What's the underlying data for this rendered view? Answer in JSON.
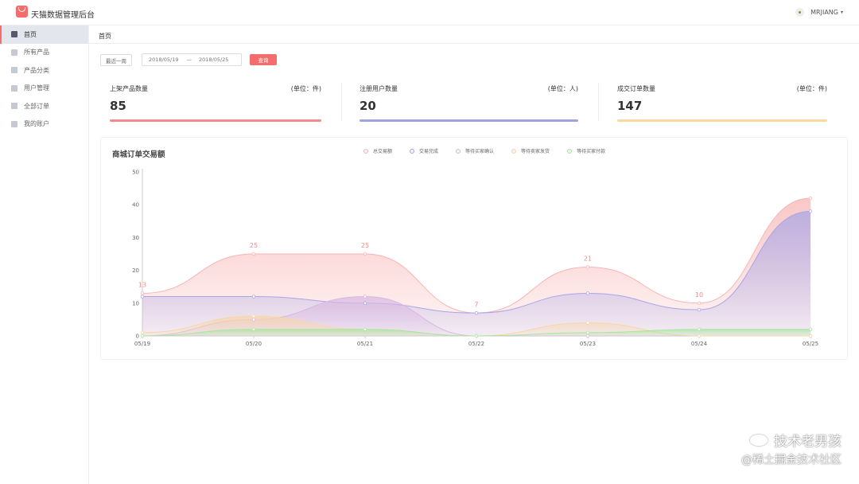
{
  "app": {
    "title": "天猫数据管理后台"
  },
  "user": {
    "name": "MRJIANG",
    "caret": "▾"
  },
  "sidebar": {
    "items": [
      {
        "label": "首页",
        "icon": "home-icon"
      },
      {
        "label": "所有产品",
        "icon": "product-icon"
      },
      {
        "label": "产品分类",
        "icon": "category-icon"
      },
      {
        "label": "用户管理",
        "icon": "user-icon"
      },
      {
        "label": "全部订单",
        "icon": "order-icon"
      },
      {
        "label": "我的账户",
        "icon": "gear-icon"
      }
    ]
  },
  "breadcrumb": "首页",
  "filter": {
    "range_button": "最近一周",
    "start_date": "2018/05/19",
    "separator": "—",
    "end_date": "2018/05/25",
    "query_button": "查询"
  },
  "stats": [
    {
      "title": "上架产品数量",
      "unit": "(单位：件)",
      "value": "85",
      "color": "#f28b8b"
    },
    {
      "title": "注册用户数量",
      "unit": "(单位：人)",
      "value": "20",
      "color": "#9fa3e3"
    },
    {
      "title": "成交订单数量",
      "unit": "(单位：件)",
      "value": "147",
      "color": "#f9d9a0"
    }
  ],
  "watermark": {
    "line1": "技术老男孩",
    "line2": "@稀土掘金技术社区"
  },
  "chart_data": {
    "type": "area",
    "title": "商城订单交易额",
    "categories": [
      "05/19",
      "05/20",
      "05/21",
      "05/22",
      "05/23",
      "05/24",
      "05/25"
    ],
    "ylim": [
      0,
      50
    ],
    "yticks": [
      0,
      10,
      20,
      30,
      40,
      50
    ],
    "grid": false,
    "legend_position": "top",
    "series": [
      {
        "name": "总交易额",
        "values": [
          13,
          25,
          25,
          7,
          21,
          10,
          42
        ],
        "color": "#f8b4b4",
        "labels": true
      },
      {
        "name": "交易完成",
        "values": [
          12,
          12,
          10,
          7,
          13,
          8,
          38
        ],
        "color": "#a9a6e6"
      },
      {
        "name": "等待买家确认",
        "values": [
          0,
          5,
          12,
          0,
          0,
          0,
          0
        ],
        "color": "#d8b8e2"
      },
      {
        "name": "等待卖家发货",
        "values": [
          1,
          6,
          2,
          0,
          4,
          0,
          0
        ],
        "color": "#f7d7a6"
      },
      {
        "name": "等待买家付款",
        "values": [
          0,
          2,
          2,
          0,
          1,
          2,
          2
        ],
        "color": "#a8e6a0"
      }
    ]
  }
}
